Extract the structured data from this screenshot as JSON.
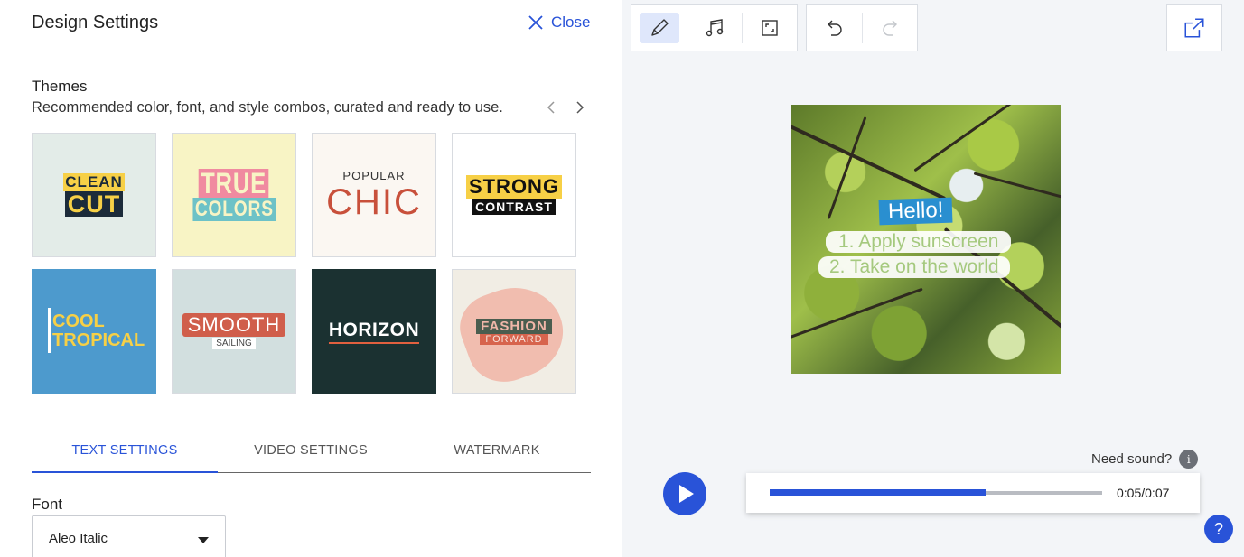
{
  "panel": {
    "title": "Design Settings",
    "close_label": "Close"
  },
  "themes": {
    "heading": "Themes",
    "subtitle": "Recommended color, font, and style combos, curated and ready to use.",
    "items": [
      {
        "line1": "CLEAN",
        "line2": "CUT"
      },
      {
        "line1": "TRUE",
        "line2": "COLORS"
      },
      {
        "line1": "POPULAR",
        "line2": "CHIC"
      },
      {
        "line1": "STRONG",
        "line2": "CONTRAST"
      },
      {
        "line1": "COOL",
        "line2": "TROPICAL"
      },
      {
        "line1": "SMOOTH",
        "line2": "SAILING"
      },
      {
        "line1": "HORIZON"
      },
      {
        "line1": "FASHION",
        "line2": "FORWARD"
      }
    ]
  },
  "tabs": [
    {
      "label": "TEXT SETTINGS",
      "active": true
    },
    {
      "label": "VIDEO SETTINGS",
      "active": false
    },
    {
      "label": "WATERMARK",
      "active": false
    }
  ],
  "font": {
    "label": "Font",
    "selected": "Aleo Italic"
  },
  "toolbar": {
    "tools": [
      "pen-icon",
      "music-note-icon",
      "resize-icon",
      "undo-icon",
      "redo-icon",
      "share-icon"
    ],
    "active_tool": "pen-icon"
  },
  "video": {
    "hello": "Hello!",
    "line1": "1. Apply sunscreen",
    "line2": "2. Take on the world"
  },
  "player": {
    "need_sound": "Need sound?",
    "time": "0:05/0:07",
    "progress": 0.65
  },
  "colors": {
    "accent": "#2953d8"
  }
}
